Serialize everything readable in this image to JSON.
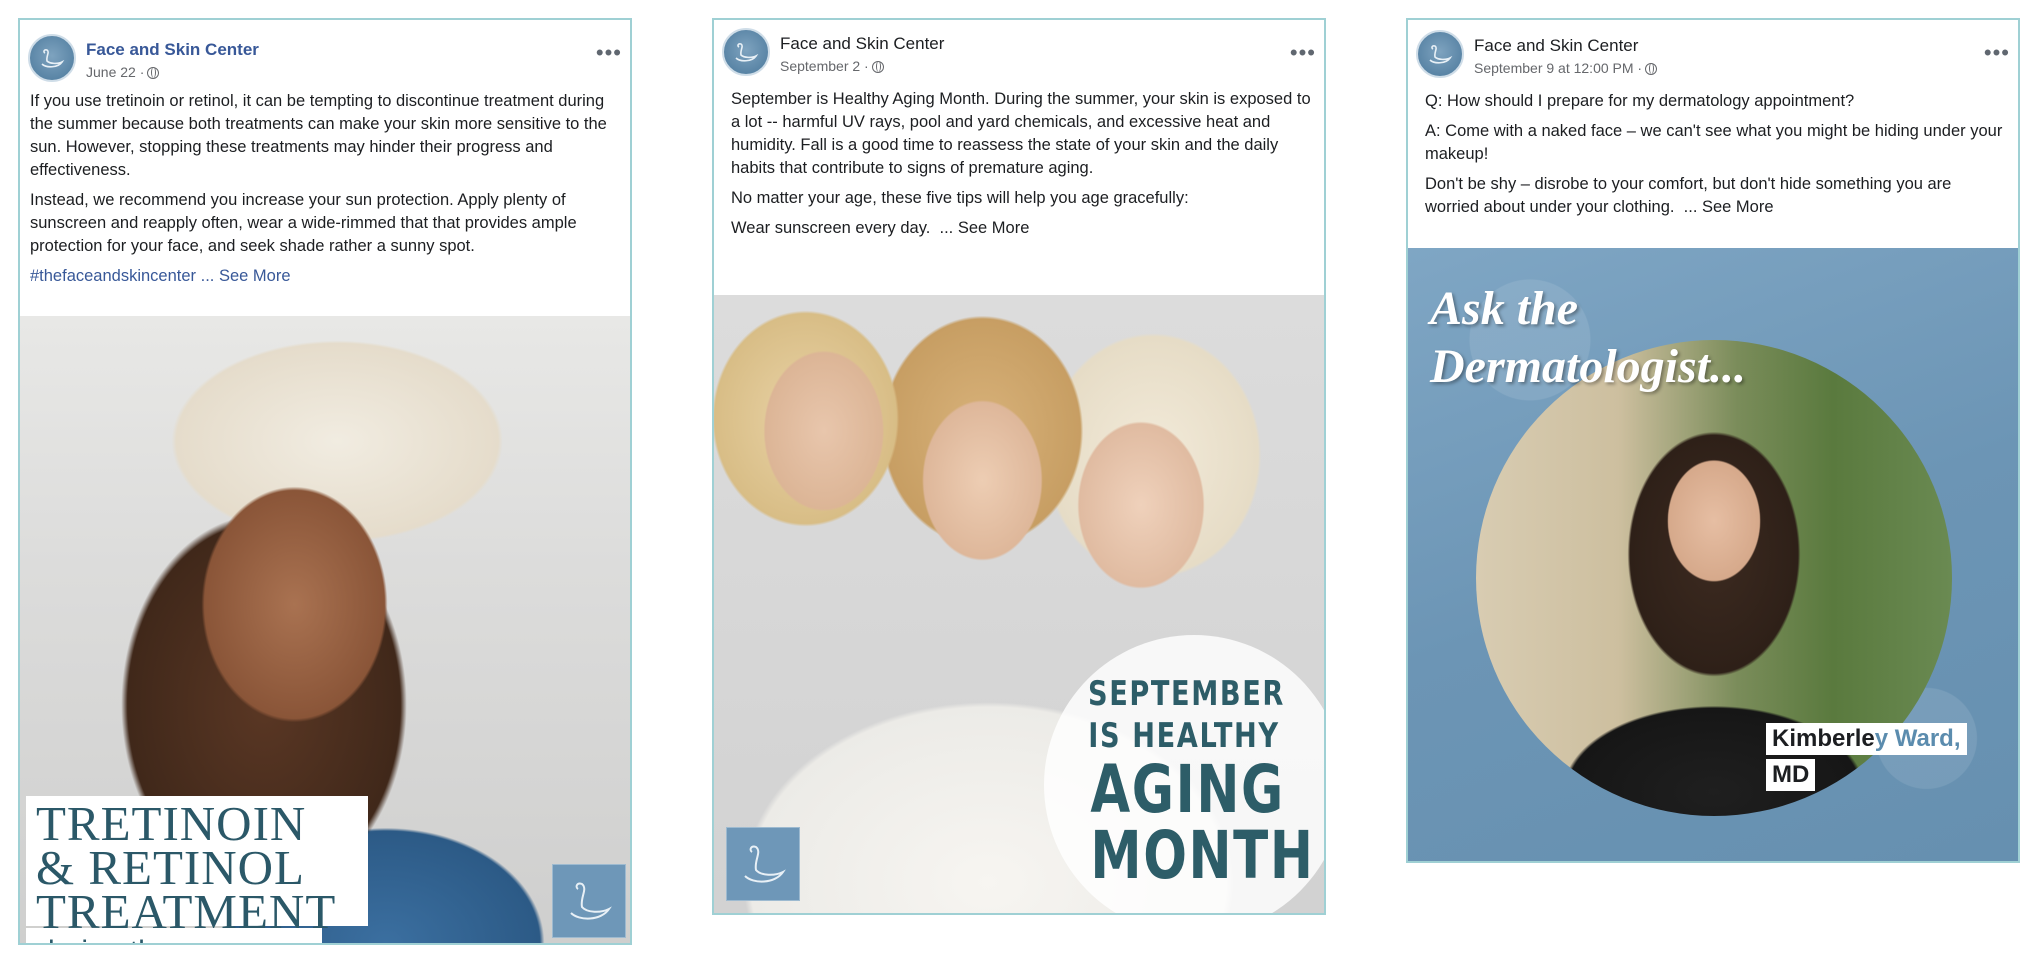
{
  "posts": [
    {
      "page_name": "Face and Skin Center",
      "meta": "June 22 ·",
      "more": "•••",
      "paragraphs": [
        "If you use tretinoin or retinol, it can be tempting to discontinue treatment during the summer because both treatments can make your skin more sensitive to the sun. However, stopping these treatments may hinder their progress and effectiveness.",
        "Instead, we recommend you increase your sun protection. Apply plenty of sunscreen and reapply often, wear a wide-rimmed that that provides ample protection for your face, and seek shade rather a sunny spot."
      ],
      "hashtag": "#thefaceandskincenter",
      "see_more": "... See More",
      "image_title": [
        "TRETINOIN",
        "& RETINOL",
        "TREATMENT"
      ],
      "image_subtitle": "during the summer."
    },
    {
      "page_name": "Face and Skin Center",
      "meta": "September 2 ·",
      "more": "•••",
      "paragraphs": [
        "September is Healthy Aging Month. During the summer, your skin is exposed to a lot -- harmful UV rays, pool and yard chemicals, and excessive heat and humidity. Fall is a good time to reassess the state of your skin and the daily habits that contribute to signs of premature aging.",
        "No matter your age, these five tips will help you age gracefully:"
      ],
      "last_line": "Wear sunscreen every day.",
      "see_more": "... See More",
      "image_lines": [
        "SEPTEMBER",
        "IS HEALTHY",
        "AGING",
        "MONTH"
      ]
    },
    {
      "page_name": "Face and Skin Center",
      "meta": "September 9 at 12:00 PM ·",
      "more": "•••",
      "paragraphs": [
        "Q: How should I prepare for my dermatology appointment?",
        "A: Come with a naked face – we can't see what you might be hiding under your makeup!"
      ],
      "last_line": "Don't be shy – disrobe to your comfort, but don't hide something you are worried about under your clothing.",
      "see_more": "... See More",
      "image_title": [
        "Ask the",
        "Dermatologist..."
      ],
      "name_line1_a": "Kimberle",
      "name_line1_b": "y Ward,",
      "name_line2": "MD"
    }
  ],
  "colors": {
    "link": "#385898",
    "frame": "#9fd0d4",
    "brand_teal": "#2b5868",
    "brand_blue": "#6e97b8"
  }
}
